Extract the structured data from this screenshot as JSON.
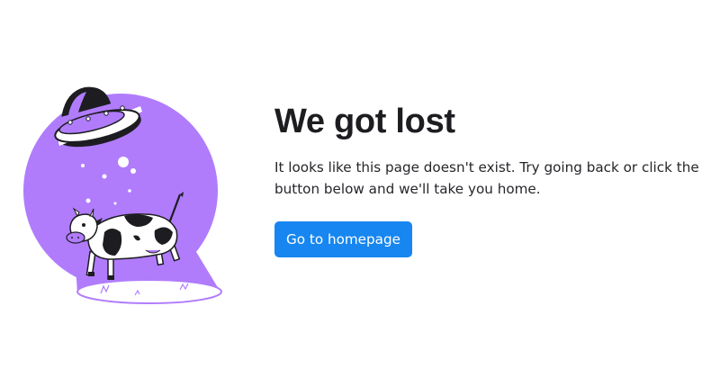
{
  "page": {
    "title": "We got lost",
    "message": "It looks like this page doesn't exist. Try going back or click the button below and we'll take you home.",
    "home_button_label": "Go to homepage"
  },
  "illustration": {
    "icon": "ufo-abducting-cow-illustration"
  },
  "colors": {
    "accent_purple": "#b07cfc",
    "button_blue": "#1786f0",
    "text_dark": "#1d1d21",
    "outline": "#1d1d21"
  }
}
